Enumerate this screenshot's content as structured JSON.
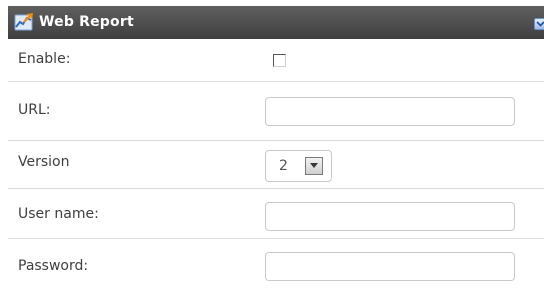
{
  "panel": {
    "title": "Web Report",
    "icon": "chart-icon",
    "collapse_icon": "chevron-down-icon"
  },
  "fields": {
    "enable": {
      "label": "Enable:",
      "checked": false
    },
    "url": {
      "label": "URL:",
      "value": ""
    },
    "version": {
      "label": "Version",
      "selected": "2"
    },
    "username": {
      "label": "User name:",
      "value": ""
    },
    "password": {
      "label": "Password:",
      "value": ""
    }
  },
  "colors": {
    "header_bg": "#4f4f4f",
    "header_text": "#ffffff",
    "label_text": "#3f3f3f",
    "row_divider": "#dcdcdc"
  }
}
